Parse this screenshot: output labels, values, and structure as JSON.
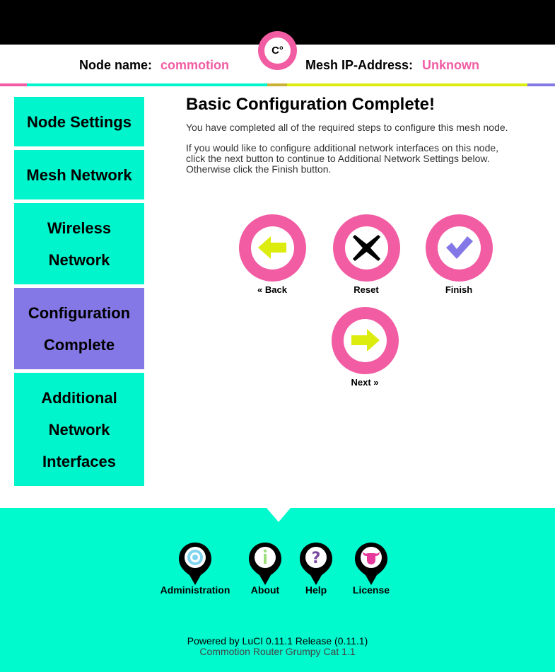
{
  "header": {
    "node_name_label": "Node name:",
    "node_name_value": "commotion",
    "mesh_ip_label": "Mesh IP-Address:",
    "mesh_ip_value": "Unknown",
    "logo_text": "C°"
  },
  "sidebar": {
    "items": [
      {
        "label": "Node Settings",
        "active": false
      },
      {
        "label": "Mesh Network",
        "active": false
      },
      {
        "label": "Wireless Network",
        "active": false
      },
      {
        "label": "Configuration Complete",
        "active": true
      },
      {
        "label": "Additional Network Interfaces",
        "active": false
      }
    ]
  },
  "main": {
    "title": "Basic Configuration Complete!",
    "paragraph1": "You have completed all of the required steps to configure this mesh node.",
    "paragraph2_line1": "If you would like to configure additional network interfaces on this node,",
    "paragraph2_line2": "click the next button to continue to Additional Network Settings below.",
    "paragraph2_line3": "Otherwise click the Finish button."
  },
  "buttons": {
    "back_label": "« Back",
    "reset_label": "Reset",
    "finish_label": "Finish",
    "next_label": "Next »"
  },
  "footer": {
    "links": [
      {
        "label": "Administration",
        "icon": "target-icon"
      },
      {
        "label": "About",
        "icon": "info-icon"
      },
      {
        "label": "Help",
        "icon": "question-icon"
      },
      {
        "label": "License",
        "icon": "bull-icon"
      }
    ],
    "powered_by": "Powered by LuCI 0.11.1 Release (0.11.1)",
    "firmware": "Commotion Router Grumpy Cat 1.1"
  },
  "colors": {
    "accent_pink": "#f15ca3",
    "accent_teal": "#00f5cc",
    "accent_purple": "#8478e6",
    "accent_yellow": "#dcec0f",
    "footer_teal": "#00f9cd"
  }
}
